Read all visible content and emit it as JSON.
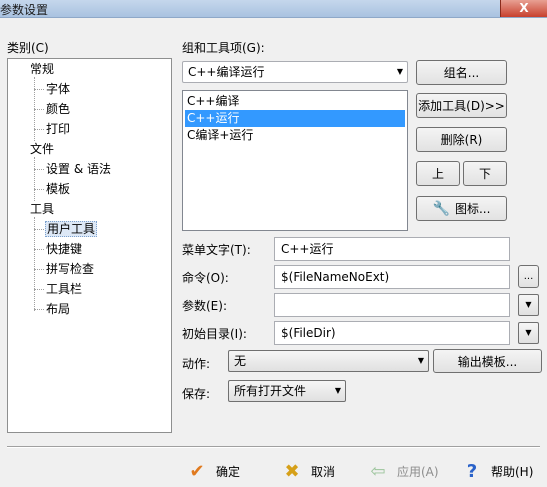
{
  "window": {
    "title": "参数设置",
    "close_glyph": "X"
  },
  "category": {
    "label": "类别(C)",
    "tree": [
      {
        "label": "常规"
      },
      {
        "label": "字体"
      },
      {
        "label": "颜色"
      },
      {
        "label": "打印"
      },
      {
        "label": "文件"
      },
      {
        "label": "设置 & 语法"
      },
      {
        "label": "模板"
      },
      {
        "label": "工具"
      },
      {
        "label": "用户工具",
        "selected": true
      },
      {
        "label": "快捷键"
      },
      {
        "label": "拼写检查"
      },
      {
        "label": "工具栏"
      },
      {
        "label": "布局"
      }
    ]
  },
  "toolgroup": {
    "label": "组和工具项(G):",
    "selected": "C++编译运行",
    "items": [
      "C++编译",
      "C++运行",
      "C编译+运行"
    ],
    "selected_index": 1
  },
  "side_buttons": {
    "group_name": "组名...",
    "add_tool": "添加工具(D)>>",
    "delete": "删除(R)",
    "up": "上",
    "down": "下",
    "icon": "图标..."
  },
  "form": {
    "menu_text_label": "菜单文字(T):",
    "menu_text_value": "C++运行",
    "command_label": "命令(O):",
    "command_value": "$(FileNameNoExt)",
    "command_browse": "...",
    "args_label": "参数(E):",
    "args_value": "",
    "initdir_label": "初始目录(I):",
    "initdir_value": "$(FileDir)",
    "action_label": "动作:",
    "action_value": "无",
    "output_template": "输出模板...",
    "save_label": "保存:",
    "save_value": "所有打开文件"
  },
  "footer": {
    "ok": "确定",
    "cancel": "取消",
    "apply": "应用(A)",
    "help": "帮助(H)"
  },
  "colors": {
    "selection": "#3399ff",
    "ok_check": "#e07a1f",
    "cancel_x": "#d6a019",
    "help_q": "#2a62c9",
    "apply_disabled": "#9bc49b"
  }
}
